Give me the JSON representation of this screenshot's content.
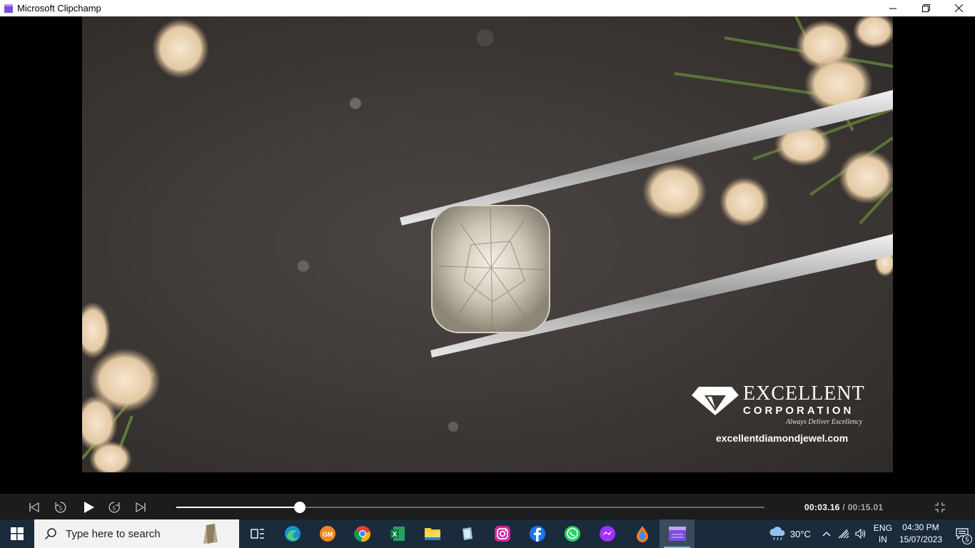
{
  "window": {
    "title": "Microsoft Clipchamp",
    "icons": [
      "clipchamp-icon",
      "minimize-icon",
      "restore-icon",
      "close-icon"
    ]
  },
  "video": {
    "logo_name": "EXCELLENT",
    "logo_sub": "CORPORATION",
    "tagline": "Always Deliver Excellency",
    "website": "excellentdiamondjewel.com"
  },
  "player": {
    "current_time": "00:03.16",
    "duration": "/ 00:15.01",
    "progress_fraction": 0.21,
    "icons": [
      "skip-back-icon",
      "rewind-5-icon",
      "play-icon",
      "forward-5-icon",
      "skip-forward-icon",
      "exit-fullscreen-icon"
    ]
  },
  "taskbar": {
    "search_placeholder": "Type here to search",
    "apps": [
      {
        "name": "task-view-icon"
      },
      {
        "name": "edge-icon"
      },
      {
        "name": "gm-app-icon",
        "label": "GM"
      },
      {
        "name": "chrome-icon"
      },
      {
        "name": "excel-icon"
      },
      {
        "name": "file-explorer-icon"
      },
      {
        "name": "generic-app-icon"
      },
      {
        "name": "instagram-icon"
      },
      {
        "name": "facebook-icon"
      },
      {
        "name": "whatsapp-icon"
      },
      {
        "name": "messenger-icon"
      },
      {
        "name": "paint-drop-icon"
      },
      {
        "name": "clipchamp-taskbar-icon"
      }
    ],
    "weather_temp": "30°C",
    "lang_line1": "ENG",
    "lang_line2": "IN",
    "time": "04:30 PM",
    "date": "15/07/2023",
    "notification_count": "5"
  },
  "colors": {
    "taskbar_bg": "#1a2b3c",
    "player_bg": "#1c1c1c",
    "accent": "#76b9ed"
  }
}
